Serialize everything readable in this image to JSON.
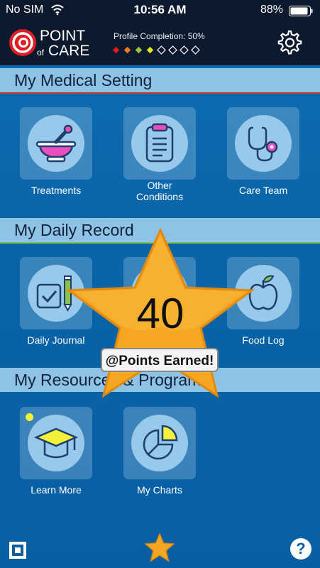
{
  "status_bar": {
    "carrier": "No SIM",
    "time": "10:56 AM",
    "battery": "88%"
  },
  "header": {
    "logo_text_1": "POINT",
    "logo_text_2": "of",
    "logo_text_3": "CARE",
    "profile_completion": "Profile Completion: 50%",
    "profile_progress_fraction": 0.5,
    "diamond_colors": [
      "#e21b23",
      "#f07a1d",
      "#9bc53d",
      "#e6e61e",
      "#ffffff",
      "#ffffff",
      "#ffffff",
      "#ffffff"
    ]
  },
  "sections": {
    "medical": {
      "title": "My Medical Setting",
      "line_color": "#c0392b",
      "items": [
        {
          "label": "Treatments",
          "icon": "mortar-pestle-icon"
        },
        {
          "label": "Other\nConditions",
          "icon": "clipboard-icon"
        },
        {
          "label": "Care Team",
          "icon": "stethoscope-icon"
        }
      ]
    },
    "daily": {
      "title": "My Daily Record",
      "line_color": "#8bc34a",
      "items": [
        {
          "label": "Daily Journal",
          "icon": "journal-check-icon"
        },
        {
          "label": "",
          "icon": "hidden-icon"
        },
        {
          "label": "Food Log",
          "icon": "apple-icon"
        }
      ]
    },
    "resources": {
      "title": "My Resources & Programs",
      "items": [
        {
          "label": "Learn More",
          "icon": "graduation-cap-icon"
        },
        {
          "label": "My Charts",
          "icon": "pie-chart-icon"
        }
      ]
    }
  },
  "popup": {
    "points": "40",
    "badge": "@Points Earned!"
  },
  "footer": {
    "help": "?"
  },
  "colors": {
    "accent": "#0a64a8",
    "star": "#f5a623",
    "icon_stroke": "#1e3f6d"
  }
}
